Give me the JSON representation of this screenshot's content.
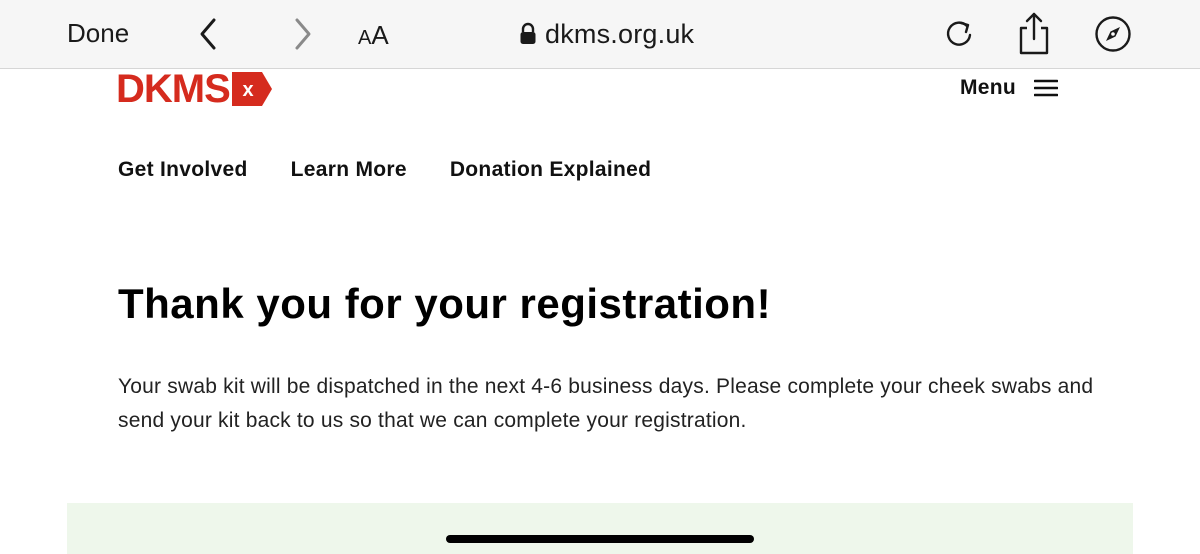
{
  "browser": {
    "done_label": "Done",
    "text_size_label_small": "A",
    "text_size_label_large": "A",
    "url_host": "dkms.org.uk"
  },
  "site": {
    "logo_text": "DKMS",
    "logo_badge": "x",
    "brand_color": "#d52b1e",
    "menu_label": "Menu",
    "nav": [
      "Get Involved",
      "Learn More",
      "Donation Explained"
    ]
  },
  "content": {
    "title": "Thank you for your registration!",
    "body": "Your swab kit will be dispatched in the next 4-6 business days. Please complete your cheek swabs and send your kit back to us so that we can complete your registration."
  },
  "icons": {
    "back": "chevron-left-icon",
    "forward": "chevron-right-icon",
    "lock": "lock-icon",
    "reload": "reload-icon",
    "share": "share-icon",
    "compass": "compass-icon",
    "menu": "hamburger-icon"
  }
}
